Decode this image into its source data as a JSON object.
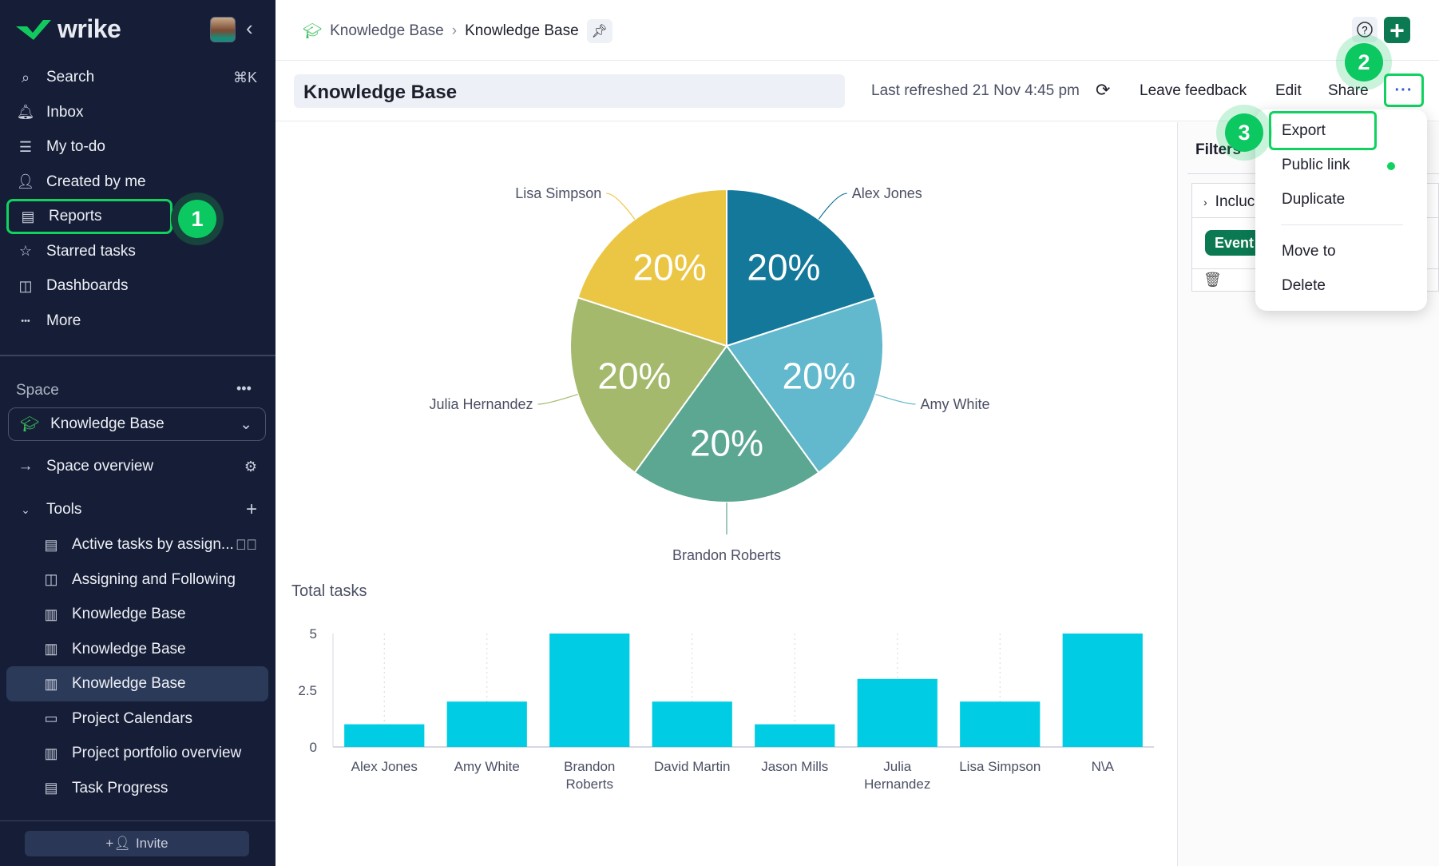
{
  "sidebar": {
    "logo": "wrike",
    "nav": [
      {
        "label": "Search",
        "icon": "search-icon",
        "shortcut": "⌘K"
      },
      {
        "label": "Inbox",
        "icon": "bell-icon"
      },
      {
        "label": "My to-do",
        "icon": "todo-icon"
      },
      {
        "label": "Created by me",
        "icon": "user-arrow-icon"
      },
      {
        "label": "Reports",
        "icon": "report-icon"
      },
      {
        "label": "Starred tasks",
        "icon": "star-icon"
      },
      {
        "label": "Dashboards",
        "icon": "dashboard-icon"
      },
      {
        "label": "More",
        "icon": "more-icon"
      }
    ],
    "space_label": "Space",
    "space_select": "Knowledge Base",
    "space_overview": "Space overview",
    "tools_label": "Tools",
    "tools": [
      {
        "label": "Active tasks by assign...",
        "icon": "report-icon"
      },
      {
        "label": "Assigning and Following",
        "icon": "dashboard-icon"
      },
      {
        "label": "Knowledge Base",
        "icon": "portfolio-icon"
      },
      {
        "label": "Knowledge Base",
        "icon": "portfolio-icon"
      },
      {
        "label": "Knowledge Base",
        "icon": "portfolio-icon",
        "active": true
      },
      {
        "label": "Project Calendars",
        "icon": "calendar-icon"
      },
      {
        "label": "Project portfolio overview",
        "icon": "portfolio-icon"
      },
      {
        "label": "Task Progress",
        "icon": "report-icon"
      }
    ],
    "invite": "Invite"
  },
  "badges": [
    "1",
    "2",
    "3"
  ],
  "breadcrumb": [
    "Knowledge Base",
    "Knowledge Base"
  ],
  "header": {
    "title": "Knowledge Base",
    "last_refreshed": "Last refreshed 21 Nov 4:45 pm",
    "leave_feedback": "Leave feedback",
    "edit": "Edit",
    "share": "Share",
    "more": "···"
  },
  "filters": {
    "title": "Filters",
    "include": "Incluc",
    "chip": "Event"
  },
  "menu": {
    "items": [
      "Export",
      "Public link",
      "Duplicate",
      "Move to",
      "Delete"
    ],
    "status_color": "#10d35f"
  },
  "colors": {
    "sidebar": "#161e37",
    "accent": "#10d35f",
    "bar": "#00cde3"
  },
  "chart_data": [
    {
      "type": "pie",
      "labels": [
        "Alex Jones",
        "Amy White",
        "Brandon Roberts",
        "Julia Hernandez",
        "Lisa Simpson"
      ],
      "values": [
        20,
        20,
        20,
        20,
        20
      ],
      "data_labels": [
        "20%",
        "20%",
        "20%",
        "20%",
        "20%"
      ],
      "colors": [
        "#137899",
        "#62b8cc",
        "#5ca792",
        "#a4b96c",
        "#ebc645"
      ]
    },
    {
      "type": "bar",
      "title": "Total tasks",
      "categories": [
        "Alex Jones",
        "Amy White",
        "Brandon Roberts",
        "David Martin",
        "Jason Mills",
        "Julia Hernandez",
        "Lisa Simpson",
        "N\\A"
      ],
      "values": [
        1,
        2,
        5,
        2,
        1,
        3,
        2,
        5
      ],
      "ylim": [
        0,
        5
      ],
      "yticks": [
        "0",
        "2.5",
        "5"
      ],
      "grid": "vertical dotted",
      "color": "#00cde3"
    }
  ]
}
